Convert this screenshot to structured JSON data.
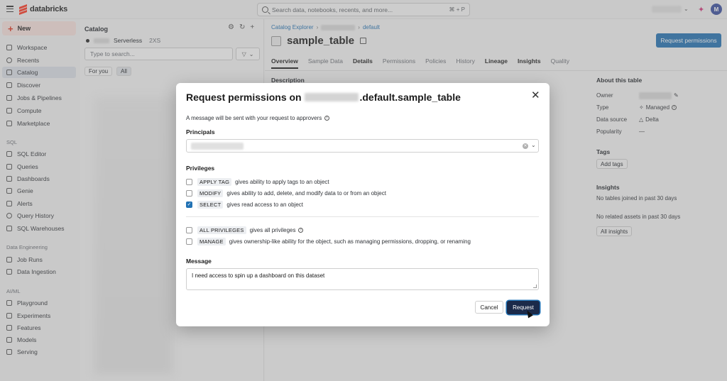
{
  "topbar": {
    "logo_text": "databricks",
    "search_placeholder": "Search data, notebooks, recents, and more...",
    "search_shortcut": "⌘ + P",
    "avatar_initial": "M"
  },
  "sidebar": {
    "new_label": "New",
    "items": [
      {
        "label": "Workspace",
        "icon": "folder-icon"
      },
      {
        "label": "Recents",
        "icon": "clock-icon"
      },
      {
        "label": "Catalog",
        "icon": "catalog-icon",
        "active": true
      },
      {
        "label": "Discover",
        "icon": "discover-icon"
      },
      {
        "label": "Jobs & Pipelines",
        "icon": "jobs-icon"
      },
      {
        "label": "Compute",
        "icon": "cloud-icon"
      },
      {
        "label": "Marketplace",
        "icon": "store-icon"
      }
    ],
    "sql_section": "SQL",
    "sql_items": [
      "SQL Editor",
      "Queries",
      "Dashboards",
      "Genie",
      "Alerts",
      "Query History",
      "SQL Warehouses"
    ],
    "de_section": "Data Engineering",
    "de_items": [
      "Job Runs",
      "Data Ingestion"
    ],
    "aiml_section": "AI/ML",
    "aiml_items": [
      "Playground",
      "Experiments",
      "Features",
      "Models",
      "Serving"
    ]
  },
  "catalog_panel": {
    "title": "Catalog",
    "compute_name": "Serverless",
    "compute_size": "2XS",
    "search_placeholder": "Type to search...",
    "chip_for_you": "For you",
    "chip_all": "All"
  },
  "main": {
    "breadcrumb_root": "Catalog Explorer",
    "breadcrumb_schema": "default",
    "table_name": "sample_table",
    "request_permissions_label": "Request permissions",
    "tabs": [
      "Overview",
      "Sample Data",
      "Details",
      "Permissions",
      "Policies",
      "History",
      "Lineage",
      "Insights",
      "Quality"
    ],
    "description_label": "Description",
    "about": {
      "title": "About this table",
      "owner_key": "Owner",
      "type_key": "Type",
      "type_value": "Managed",
      "datasource_key": "Data source",
      "datasource_value": "Delta",
      "popularity_key": "Popularity",
      "popularity_value": "—"
    },
    "tags_title": "Tags",
    "add_tags_label": "Add tags",
    "insights_title": "Insights",
    "insights_line1": "No tables joined in past 30 days",
    "insights_line2": "No related assets in past 30 days",
    "all_insights_label": "All insights"
  },
  "modal": {
    "title_prefix": "Request permissions on",
    "title_suffix": ".default.sample_table",
    "note": "A message will be sent with your request to approvers",
    "principals_label": "Principals",
    "privileges_label": "Privileges",
    "privileges": [
      {
        "tag": "APPLY TAG",
        "desc": "gives ability to apply tags to an object",
        "checked": false
      },
      {
        "tag": "MODIFY",
        "desc": "gives ability to add, delete, and modify data to or from an object",
        "checked": false
      },
      {
        "tag": "SELECT",
        "desc": "gives read access to an object",
        "checked": true
      }
    ],
    "privileges_extra": [
      {
        "tag": "ALL PRIVILEGES",
        "desc": "gives all privileges",
        "checked": false
      },
      {
        "tag": "MANAGE",
        "desc": "gives ownership-like ability for the object, such as managing permissions, dropping, or renaming",
        "checked": false
      }
    ],
    "message_label": "Message",
    "message_value": "I need access to spin up a dashboard on this dataset",
    "cancel_label": "Cancel",
    "request_label": "Request"
  },
  "colors": {
    "accent": "#2272b4",
    "brand": "#ff3621",
    "request_button": "#1b2a4a"
  }
}
